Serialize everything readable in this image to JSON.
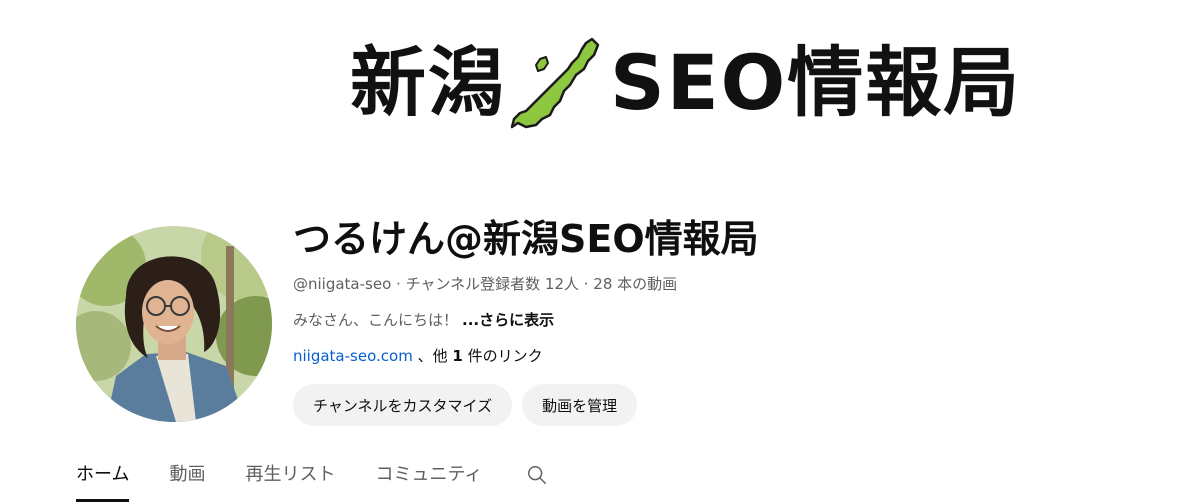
{
  "banner": {
    "text_left": "新潟",
    "text_right": "SEO情報局",
    "map_icon": "niigata-map-icon",
    "map_color": "#8dc63f"
  },
  "channel": {
    "name": "つるけん@新潟SEO情報局",
    "handle": "@niigata-seo",
    "separator": " · ",
    "subscribers": "チャンネル登録者数 12人",
    "videos": "28 本の動画",
    "description": "みなさん、こんにちは！",
    "more_label": "...さらに表示",
    "link_text": "niigata-seo.com",
    "link_suffix_pre": " 、他 ",
    "link_count": "1",
    "link_suffix_post": " 件のリンク"
  },
  "buttons": {
    "customize": "チャンネルをカスタマイズ",
    "manage": "動画を管理"
  },
  "tabs": [
    {
      "label": "ホーム",
      "active": true
    },
    {
      "label": "動画",
      "active": false
    },
    {
      "label": "再生リスト",
      "active": false
    },
    {
      "label": "コミュニティ",
      "active": false
    }
  ],
  "tab_search_icon": "search-icon",
  "colors": {
    "link": "#065fd4",
    "text_secondary": "#606060",
    "button_bg": "#f2f2f2"
  }
}
